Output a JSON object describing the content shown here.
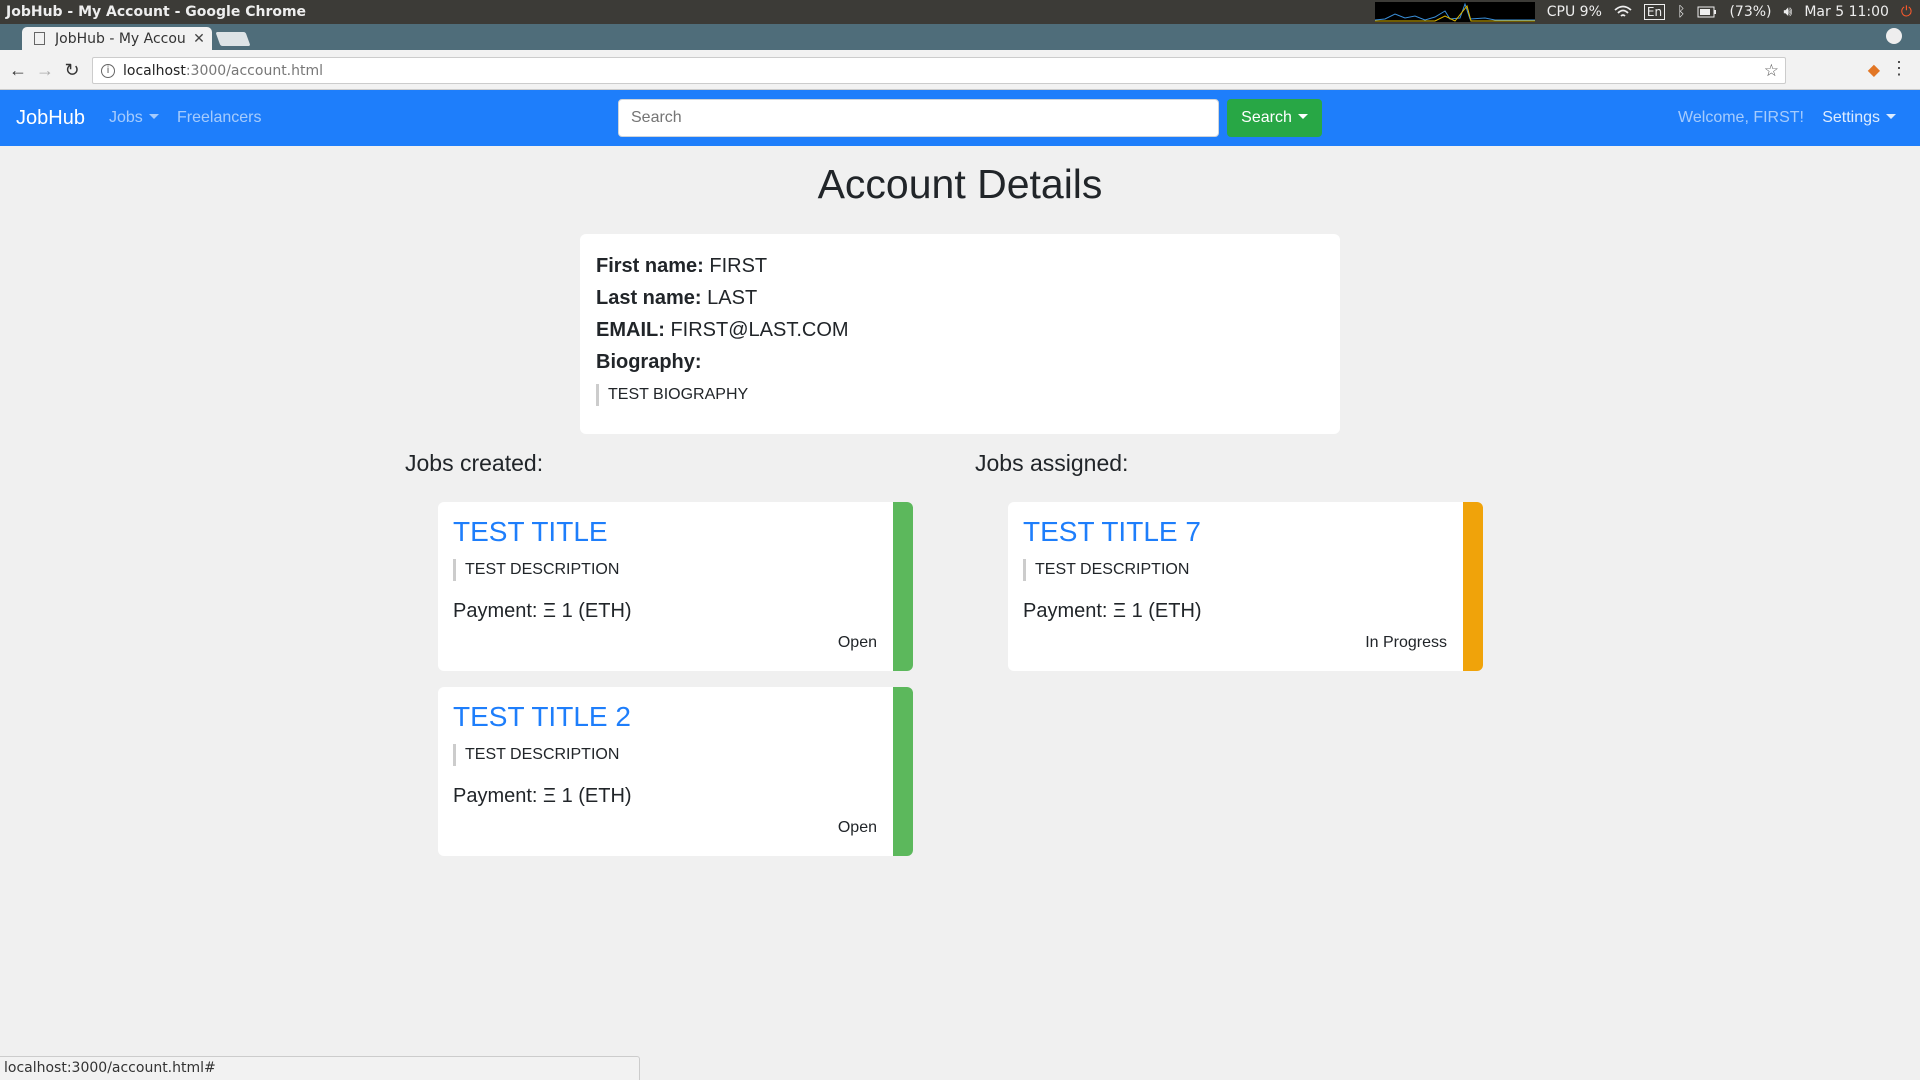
{
  "os": {
    "window_title": "JobHub - My Account - Google Chrome",
    "cpu": "CPU 9%",
    "keyboard": "En",
    "battery": "(73%)",
    "clock": "Mar  5 11:00"
  },
  "browser": {
    "tab_title": "JobHub - My Accou",
    "url_host": "localhost",
    "url_path": ":3000/account.html",
    "status_url": "localhost:3000/account.html#"
  },
  "navbar": {
    "brand": "JobHub",
    "jobs": "Jobs",
    "freelancers": "Freelancers",
    "search_placeholder": "Search",
    "search_button": "Search",
    "welcome": "Welcome, FIRST!",
    "settings": "Settings"
  },
  "account": {
    "page_title": "Account Details",
    "first_name_label": "First name:",
    "first_name": "FIRST",
    "last_name_label": "Last name:",
    "last_name": "LAST",
    "email_label": "EMAIL:",
    "email": "FIRST@LAST.COM",
    "biography_label": "Biography:",
    "biography": "TEST BIOGRAPHY"
  },
  "jobs_created": {
    "heading": "Jobs created:",
    "items": [
      {
        "title": "TEST TITLE",
        "description": "TEST DESCRIPTION",
        "payment": "Payment: Ξ 1 (ETH)",
        "status": "Open",
        "color": "#5cb85c"
      },
      {
        "title": "TEST TITLE 2",
        "description": "TEST DESCRIPTION",
        "payment": "Payment: Ξ 1 (ETH)",
        "status": "Open",
        "color": "#5cb85c"
      }
    ]
  },
  "jobs_assigned": {
    "heading": "Jobs assigned:",
    "items": [
      {
        "title": "TEST TITLE 7",
        "description": "TEST DESCRIPTION",
        "payment": "Payment: Ξ 1 (ETH)",
        "status": "In Progress",
        "color": "#f0a30a"
      }
    ]
  },
  "colors": {
    "navbar": "#1e7efb",
    "search_button": "#28a745",
    "open": "#5cb85c",
    "in_progress": "#f0a30a"
  }
}
